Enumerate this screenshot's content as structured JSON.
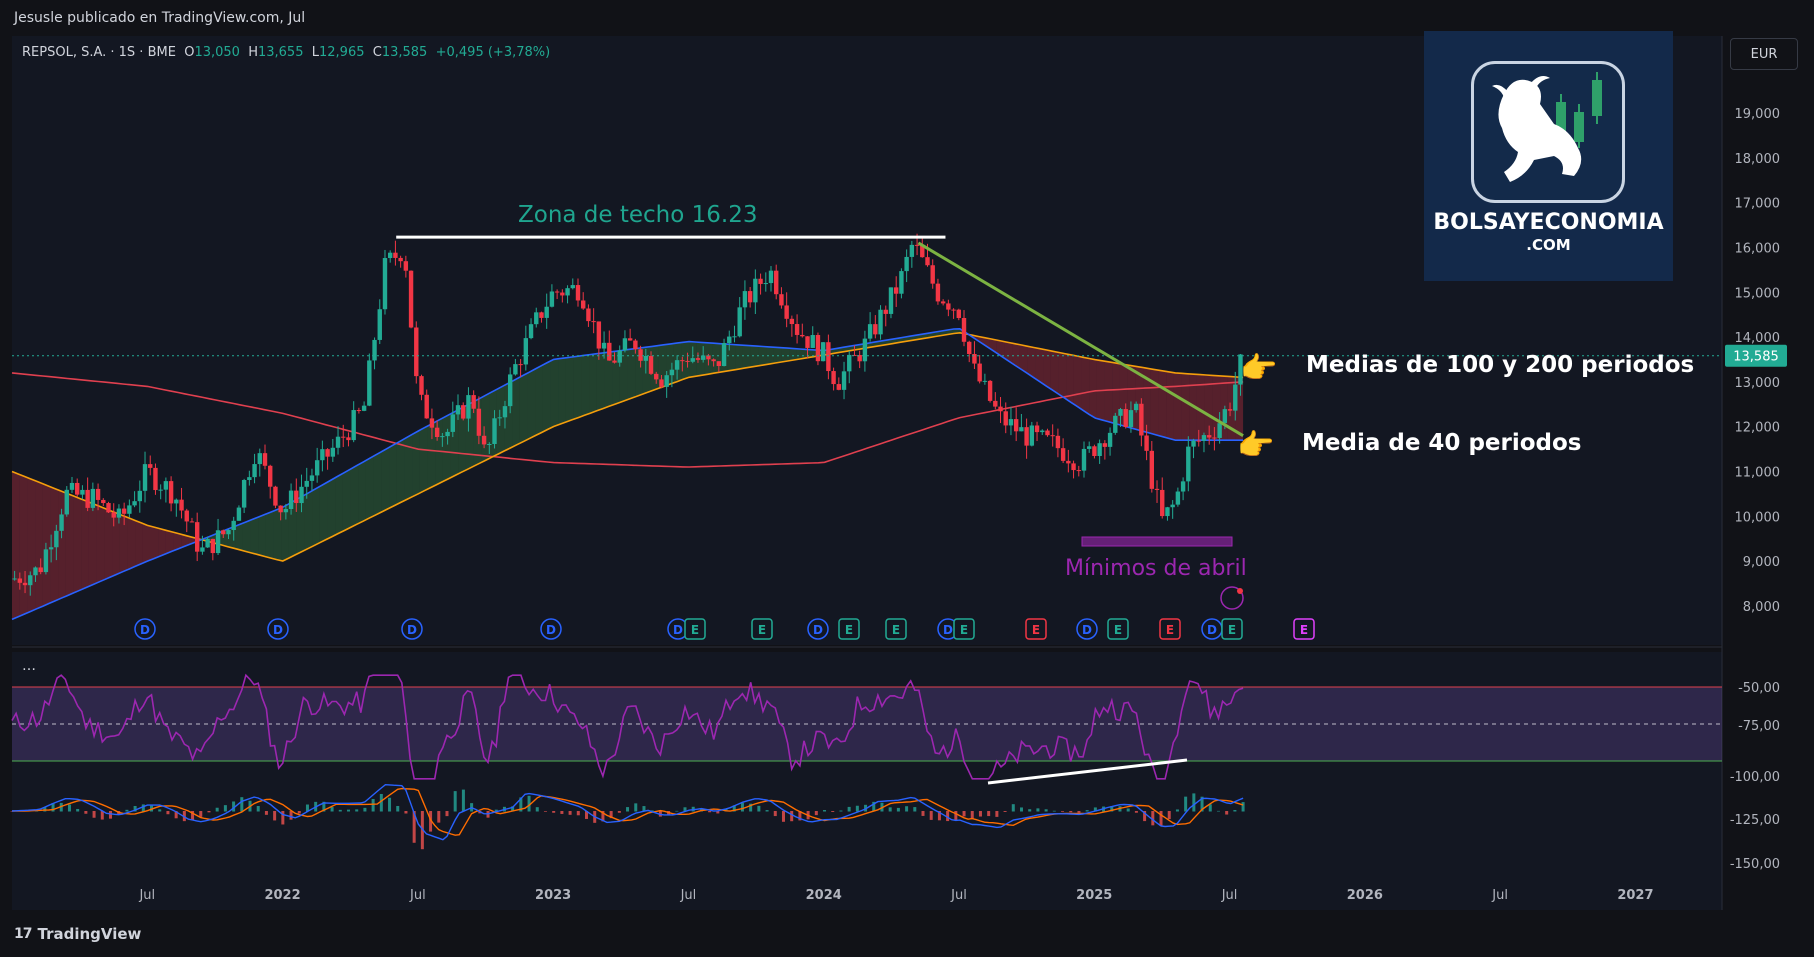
{
  "header": {
    "published": "Jesusle publicado en TradingView.com, Jul"
  },
  "legend": {
    "symbol": "REPSOL, S.A. · 1S · BME",
    "open_label": "O",
    "open": "13,050",
    "high_label": "H",
    "high": "13,655",
    "low_label": "L",
    "low": "12,965",
    "close_label": "C",
    "close": "13,585",
    "change": "+0,495 (+3,78%)"
  },
  "currency_button": "EUR",
  "logo": {
    "name": "BOLSAYECONOMIA",
    "domain": ".COM"
  },
  "annotations": {
    "ceiling": "Zona de techo 16.23",
    "medias_100_200": "Medias de 100 y 200 periodos",
    "media_40": "Media de 40 periodos",
    "minimos": "Mínimos de abril"
  },
  "footer": {
    "brand": "TradingView"
  },
  "colors": {
    "up": "#22ab94",
    "down": "#f23645",
    "ma40": "#2962ff",
    "ma100": "#f59e0b",
    "ma200": "#e0404f",
    "rsi": "#9c27b0",
    "macd": "#2962ff",
    "signal": "#ff6d00",
    "background": "#111217"
  },
  "icons": {
    "hand": "pointing-hand-icon",
    "tradingview": "tradingview-logo-icon",
    "bull": "bull-logo-icon"
  },
  "chart_data": {
    "type": "candlestick",
    "price_axis": {
      "ticks": [
        "19,000",
        "18,000",
        "17,000",
        "16,000",
        "15,000",
        "14,000",
        "13,000",
        "12,000",
        "11,000",
        "10,000",
        "9,000",
        "8,000"
      ],
      "ylim": [
        7600,
        19900
      ],
      "last_price_label": "13,585"
    },
    "time_axis": {
      "labels": [
        "Jul",
        "2022",
        "Jul",
        "2023",
        "Jul",
        "2024",
        "Jul",
        "2025",
        "Jul",
        "2026",
        "Jul",
        "2027"
      ],
      "positions_year": [
        2021.5,
        2022.0,
        2022.5,
        2023.0,
        2023.5,
        2024.0,
        2024.5,
        2025.0,
        2025.5,
        2026.0,
        2026.5,
        2027.0
      ]
    },
    "price_path": [
      [
        2021.0,
        8.6
      ],
      [
        2021.1,
        8.8
      ],
      [
        2021.2,
        10.5
      ],
      [
        2021.3,
        10.4
      ],
      [
        2021.4,
        9.9
      ],
      [
        2021.5,
        11.0
      ],
      [
        2021.6,
        10.5
      ],
      [
        2021.7,
        9.2
      ],
      [
        2021.8,
        9.7
      ],
      [
        2021.9,
        11.5
      ],
      [
        2022.0,
        10.1
      ],
      [
        2022.1,
        10.9
      ],
      [
        2022.2,
        11.6
      ],
      [
        2022.3,
        12.4
      ],
      [
        2022.38,
        15.6
      ],
      [
        2022.45,
        16.0
      ],
      [
        2022.5,
        12.6
      ],
      [
        2022.6,
        11.8
      ],
      [
        2022.7,
        12.7
      ],
      [
        2022.75,
        11.3
      ],
      [
        2022.85,
        13.2
      ],
      [
        2022.95,
        14.5
      ],
      [
        2023.0,
        15.0
      ],
      [
        2023.1,
        15.1
      ],
      [
        2023.2,
        13.4
      ],
      [
        2023.3,
        13.9
      ],
      [
        2023.4,
        13.1
      ],
      [
        2023.5,
        13.6
      ],
      [
        2023.6,
        13.3
      ],
      [
        2023.7,
        14.7
      ],
      [
        2023.8,
        15.5
      ],
      [
        2023.9,
        14.2
      ],
      [
        2024.0,
        13.6
      ],
      [
        2024.05,
        13.0
      ],
      [
        2024.15,
        13.8
      ],
      [
        2024.28,
        15.2
      ],
      [
        2024.33,
        16.1
      ],
      [
        2024.42,
        15.0
      ],
      [
        2024.5,
        14.6
      ],
      [
        2024.55,
        13.3
      ],
      [
        2024.65,
        12.2
      ],
      [
        2024.75,
        11.8
      ],
      [
        2024.85,
        11.6
      ],
      [
        2024.95,
        11.2
      ],
      [
        2025.05,
        11.9
      ],
      [
        2025.15,
        12.4
      ],
      [
        2025.25,
        9.9
      ],
      [
        2025.3,
        10.3
      ],
      [
        2025.35,
        11.5
      ],
      [
        2025.45,
        12.0
      ],
      [
        2025.5,
        12.5
      ],
      [
        2025.55,
        13.585
      ]
    ],
    "series": [
      {
        "name": "Media de 40 periodos",
        "x": [
          2021.0,
          2021.5,
          2022.0,
          2022.5,
          2023.0,
          2023.5,
          2024.0,
          2024.5,
          2025.0,
          2025.3,
          2025.55
        ],
        "values": [
          7.7,
          9.0,
          10.2,
          11.9,
          13.5,
          13.9,
          13.7,
          14.2,
          12.2,
          11.7,
          11.7
        ]
      },
      {
        "name": "Media de 100 periodos",
        "x": [
          2021.0,
          2021.5,
          2022.0,
          2022.5,
          2023.0,
          2023.5,
          2024.0,
          2024.5,
          2025.0,
          2025.3,
          2025.55
        ],
        "values": [
          11.0,
          9.8,
          9.0,
          10.5,
          12.0,
          13.1,
          13.6,
          14.1,
          13.5,
          13.2,
          13.1
        ]
      },
      {
        "name": "Media de 200 periodos",
        "x": [
          2021.0,
          2021.5,
          2022.0,
          2022.5,
          2023.0,
          2023.5,
          2024.0,
          2024.5,
          2025.0,
          2025.3,
          2025.55
        ],
        "values": [
          13.2,
          12.9,
          12.3,
          11.5,
          11.2,
          11.1,
          11.2,
          12.2,
          12.8,
          12.9,
          13.0
        ]
      }
    ],
    "oscillator_axis": {
      "ticks": [
        "-50,00",
        "-75,00",
        "-100,00",
        "-125,00",
        "-150,00"
      ]
    },
    "event_markers": [
      "D",
      "D",
      "D",
      "D",
      "D",
      "E",
      "E",
      "D",
      "E",
      "E",
      "D",
      "E",
      "E",
      "D",
      "E",
      "E",
      "D",
      "E"
    ]
  }
}
